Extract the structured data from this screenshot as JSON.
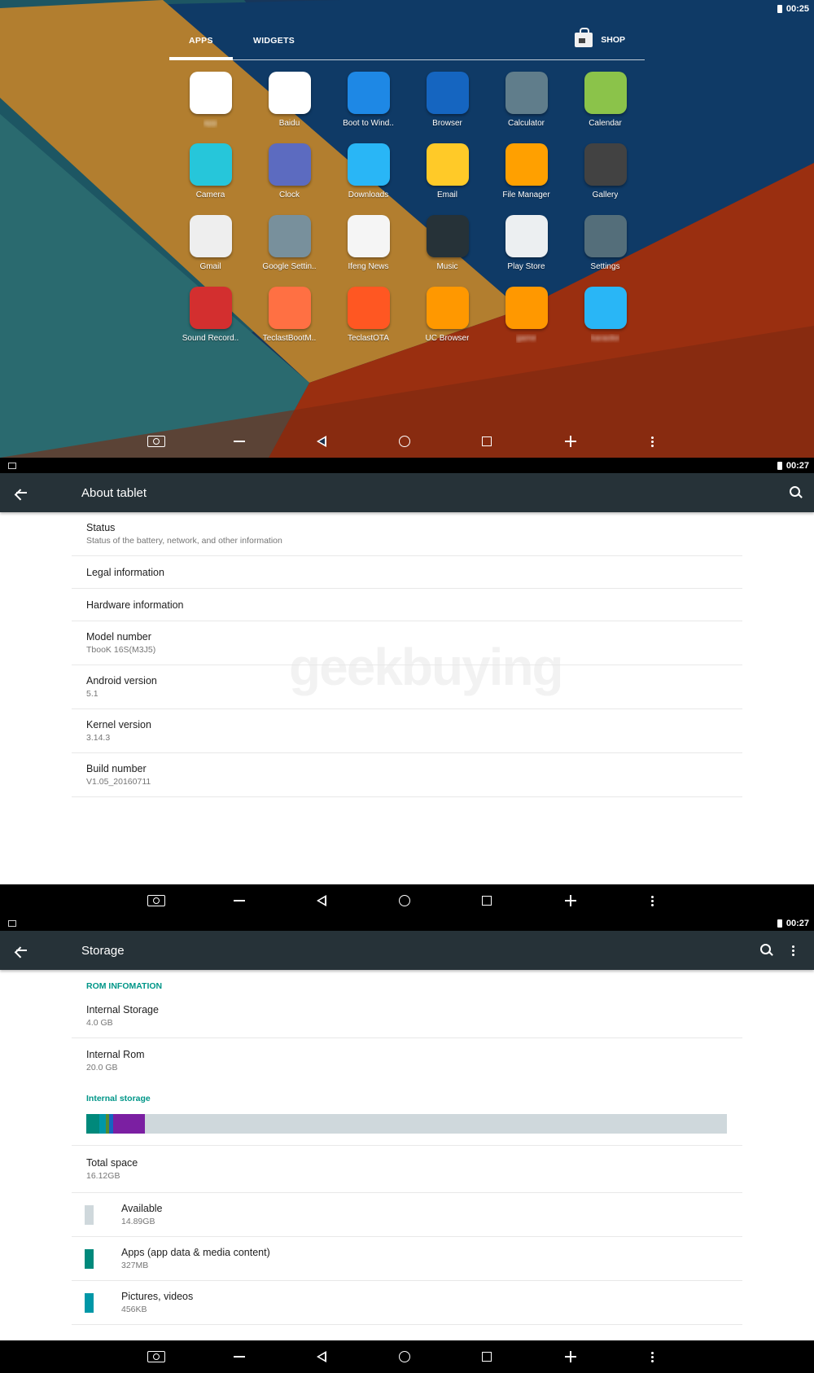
{
  "drawer": {
    "time": "00:25",
    "tabs": {
      "apps": "APPS",
      "widgets": "WIDGETS",
      "shop": "SHOP"
    },
    "apps": [
      {
        "label": "app",
        "blurred": true,
        "color": "#ffffff",
        "icon": "multicolor-icon"
      },
      {
        "label": "Baidu",
        "color": "#ffffff",
        "icon": "baidu-paw-icon"
      },
      {
        "label": "Boot to Wind..",
        "color": "#1e88e5",
        "icon": "windows-icon"
      },
      {
        "label": "Browser",
        "color": "#1565c0",
        "icon": "globe-icon"
      },
      {
        "label": "Calculator",
        "color": "#607d8b",
        "icon": "calculator-icon"
      },
      {
        "label": "Calendar",
        "color": "#8bc34a",
        "icon": "calendar-icon"
      },
      {
        "label": "Camera",
        "color": "#26c6da",
        "icon": "camera-shutter-icon"
      },
      {
        "label": "Clock",
        "color": "#5c6bc0",
        "icon": "clock-icon"
      },
      {
        "label": "Downloads",
        "color": "#29b6f6",
        "icon": "download-icon"
      },
      {
        "label": "Email",
        "color": "#ffca28",
        "icon": "email-icon"
      },
      {
        "label": "File Manager",
        "color": "#ffa000",
        "icon": "folder-icon"
      },
      {
        "label": "Gallery",
        "color": "#424242",
        "icon": "gallery-icon"
      },
      {
        "label": "Gmail",
        "color": "#eeeeee",
        "icon": "gmail-icon"
      },
      {
        "label": "Google Settin..",
        "color": "#78909c",
        "icon": "google-settings-icon"
      },
      {
        "label": "Ifeng News",
        "color": "#f5f5f5",
        "icon": "ifeng-icon"
      },
      {
        "label": "Music",
        "color": "#263238",
        "icon": "speaker-icon"
      },
      {
        "label": "Play Store",
        "color": "#eceff1",
        "icon": "play-store-icon"
      },
      {
        "label": "Settings",
        "color": "#546e7a",
        "icon": "gear-icon"
      },
      {
        "label": "Sound Record..",
        "color": "#d32f2f",
        "icon": "microphone-icon"
      },
      {
        "label": "TeclastBootM..",
        "color": "#ff7043",
        "icon": "toggle-icon"
      },
      {
        "label": "TeclastOTA",
        "color": "#ff5722",
        "icon": "ota-arrow-icon"
      },
      {
        "label": "UC Browser",
        "color": "#ff9800",
        "icon": "uc-squirrel-icon"
      },
      {
        "label": "game",
        "blurred": true,
        "color": "#ff9800",
        "icon": "playstation-buttons-icon"
      },
      {
        "label": "karaoke",
        "blurred": true,
        "color": "#29b6f6",
        "icon": "k-box-icon"
      }
    ]
  },
  "about": {
    "time": "00:27",
    "title": "About tablet",
    "watermark": "geekbuying",
    "items": [
      {
        "title": "Status",
        "sub": "Status of the battery, network, and other information"
      },
      {
        "title": "Legal information",
        "sub": ""
      },
      {
        "title": "Hardware information",
        "sub": ""
      },
      {
        "title": "Model number",
        "sub": "TbooK 16S(M3J5)"
      },
      {
        "title": "Android version",
        "sub": "5.1"
      },
      {
        "title": "Kernel version",
        "sub": "3.14.3"
      },
      {
        "title": "Build number",
        "sub": "V1.05_20160711"
      }
    ]
  },
  "storage": {
    "time": "00:27",
    "title": "Storage",
    "rom_header": "ROM INFOMATION",
    "rom_items": [
      {
        "title": "Internal Storage",
        "sub": "4.0 GB"
      },
      {
        "title": "Internal Rom",
        "sub": "20.0 GB"
      }
    ],
    "internal_header": "Internal storage",
    "bar_segments": [
      {
        "name": "apps",
        "fraction": 0.02,
        "color": "#00897b"
      },
      {
        "name": "pictures",
        "fraction": 0.01,
        "color": "#0097a7"
      },
      {
        "name": "misc-1",
        "fraction": 0.006,
        "color": "#558b2f"
      },
      {
        "name": "misc-2",
        "fraction": 0.006,
        "color": "#1565c0"
      },
      {
        "name": "misc-3",
        "fraction": 0.05,
        "color": "#7b1fa2"
      }
    ],
    "total": {
      "title": "Total space",
      "sub": "16.12GB"
    },
    "legend": [
      {
        "title": "Available",
        "sub": "14.89GB",
        "color": "#cfd8dc"
      },
      {
        "title": "Apps (app data & media content)",
        "sub": "327MB",
        "color": "#00897b"
      },
      {
        "title": "Pictures, videos",
        "sub": "456KB",
        "color": "#0097a7"
      }
    ]
  }
}
